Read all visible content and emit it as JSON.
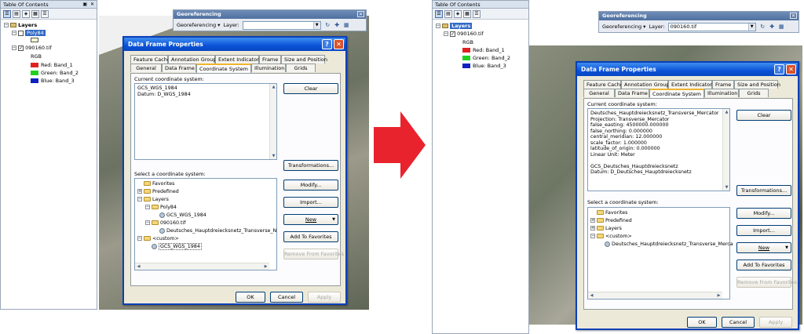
{
  "left": {
    "toc": {
      "title": "Table Of Contents",
      "pin": "❘",
      "close": "✕",
      "root": "Layers",
      "layers": [
        {
          "name": "Poly84",
          "checked": false,
          "selected": true
        },
        {
          "name": "090160.tif",
          "checked": true,
          "selected": false
        }
      ],
      "rgb": "RGB",
      "bands": [
        {
          "label": "Red:",
          "band": "Band_1",
          "color": "#e02020"
        },
        {
          "label": "Green:",
          "band": "Band_2",
          "color": "#20d020"
        },
        {
          "label": "Blue:",
          "band": "Band_3",
          "color": "#1020c0"
        }
      ]
    },
    "georef": {
      "title": "Georeferencing",
      "menu": "Georeferencing ▾",
      "layer_label": "Layer:",
      "layer_value": ""
    },
    "dialog": {
      "title": "Data Frame Properties",
      "tabs_top": [
        "Feature Cache",
        "Annotation Groups",
        "Extent Indicators",
        "Frame",
        "Size and Position"
      ],
      "tabs_bottom": [
        "General",
        "Data Frame",
        "Coordinate System",
        "Illumination",
        "Grids"
      ],
      "current_label": "Current coordinate system:",
      "current_text": "GCS_WGS_1984\nDatum: D_WGS_1984",
      "select_label": "Select a coordinate system:",
      "tree": [
        {
          "label": "Favorites",
          "pm": "",
          "type": "folder",
          "level": 0
        },
        {
          "label": "Predefined",
          "pm": "+",
          "type": "folder",
          "level": 0
        },
        {
          "label": "Layers",
          "pm": "−",
          "type": "folder",
          "level": 0
        },
        {
          "label": "Poly84",
          "pm": "−",
          "type": "folder",
          "level": 1
        },
        {
          "label": "GCS_WGS_1984",
          "pm": "",
          "type": "globe",
          "level": 2
        },
        {
          "label": "090160.tif",
          "pm": "−",
          "type": "folder",
          "level": 1
        },
        {
          "label": "Deutsches_Hauptdreiecksnetz_Transverse_N",
          "pm": "",
          "type": "globe",
          "level": 2
        },
        {
          "label": "<custom>",
          "pm": "−",
          "type": "folder",
          "level": 0
        },
        {
          "label": "GCS_WGS_1984",
          "pm": "",
          "type": "globe",
          "level": 1,
          "selected": true
        }
      ],
      "buttons": {
        "clear": "Clear",
        "transformations": "Transformations...",
        "modify": "Modify...",
        "import": "Import...",
        "new": "New",
        "add_fav": "Add To Favorites",
        "remove_fav": "Remove From Favorites",
        "ok": "OK",
        "cancel": "Cancel",
        "apply": "Apply"
      }
    }
  },
  "right": {
    "toc": {
      "title": "Table Of Contents",
      "root": "Layers",
      "layers": [
        {
          "name": "090160.tif",
          "checked": true,
          "selected": false
        }
      ],
      "rgb": "RGB",
      "bands": [
        {
          "label": "Red:",
          "band": "Band_1",
          "color": "#e02020"
        },
        {
          "label": "Green:",
          "band": "Band_2",
          "color": "#20d020"
        },
        {
          "label": "Blue:",
          "band": "Band_3",
          "color": "#1020c0"
        }
      ]
    },
    "georef": {
      "title": "Georeferencing",
      "menu": "Georeferencing ▾",
      "layer_label": "Layer:",
      "layer_value": "090160.tif"
    },
    "dialog": {
      "title": "Data Frame Properties",
      "tabs_top": [
        "Feature Cache",
        "Annotation Groups",
        "Extent Indicators",
        "Frame",
        "Size and Position"
      ],
      "tabs_bottom": [
        "General",
        "Data Frame",
        "Coordinate System",
        "Illumination",
        "Grids"
      ],
      "current_label": "Current coordinate system:",
      "current_text": "Deutsches_Hauptdreiecksnetz_Transverse_Mercator\nProjection: Transverse_Mercator\nfalse_easting: 4500000.000000\nfalse_northing: 0.000000\ncentral_meridian: 12.000000\nscale_factor: 1.000000\nlatitude_of_origin: 0.000000\nLinear Unit: Meter\n\nGCS_Deutsches_Hauptdreiecksnetz\nDatum: D_Deutsches_Hauptdreiecksnetz",
      "select_label": "Select a coordinate system:",
      "tree": [
        {
          "label": "Favorites",
          "pm": "",
          "type": "folder",
          "level": 0
        },
        {
          "label": "Predefined",
          "pm": "+",
          "type": "folder",
          "level": 0
        },
        {
          "label": "Layers",
          "pm": "+",
          "type": "folder",
          "level": 0
        },
        {
          "label": "<custom>",
          "pm": "−",
          "type": "folder",
          "level": 0
        },
        {
          "label": "Deutsches_Hauptdreiecksnetz_Transverse_Merca",
          "pm": "",
          "type": "globe",
          "level": 1
        }
      ],
      "buttons": {
        "clear": "Clear",
        "transformations": "Transformations...",
        "modify": "Modify...",
        "import": "Import...",
        "new": "New",
        "add_fav": "Add To Favorites",
        "remove_fav": "Remove From Favorites",
        "ok": "OK",
        "cancel": "Cancel",
        "apply": "Apply"
      }
    }
  },
  "colors": {
    "arrow": "#e8232d",
    "titlebar": "#0a53d8",
    "selection": "#316ac5"
  },
  "icons": {
    "arrow": "right-arrow",
    "help": "help-icon",
    "close": "close-icon"
  }
}
